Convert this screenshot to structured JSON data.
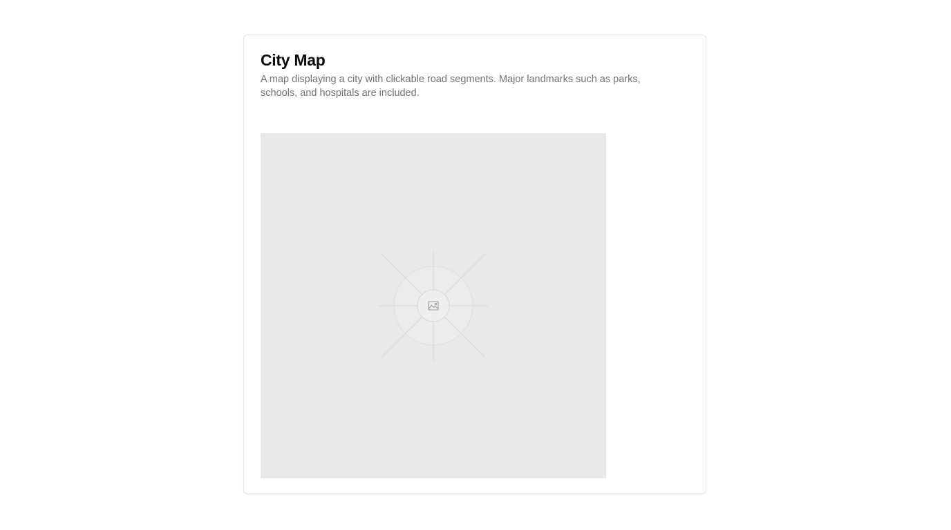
{
  "card": {
    "title": "City Map",
    "description": "A map displaying a city with clickable road segments. Major landmarks such as parks, schools, and hospitals are included."
  },
  "map": {
    "placeholder_icon": "image-icon",
    "background_color": "#e8e8e8"
  }
}
